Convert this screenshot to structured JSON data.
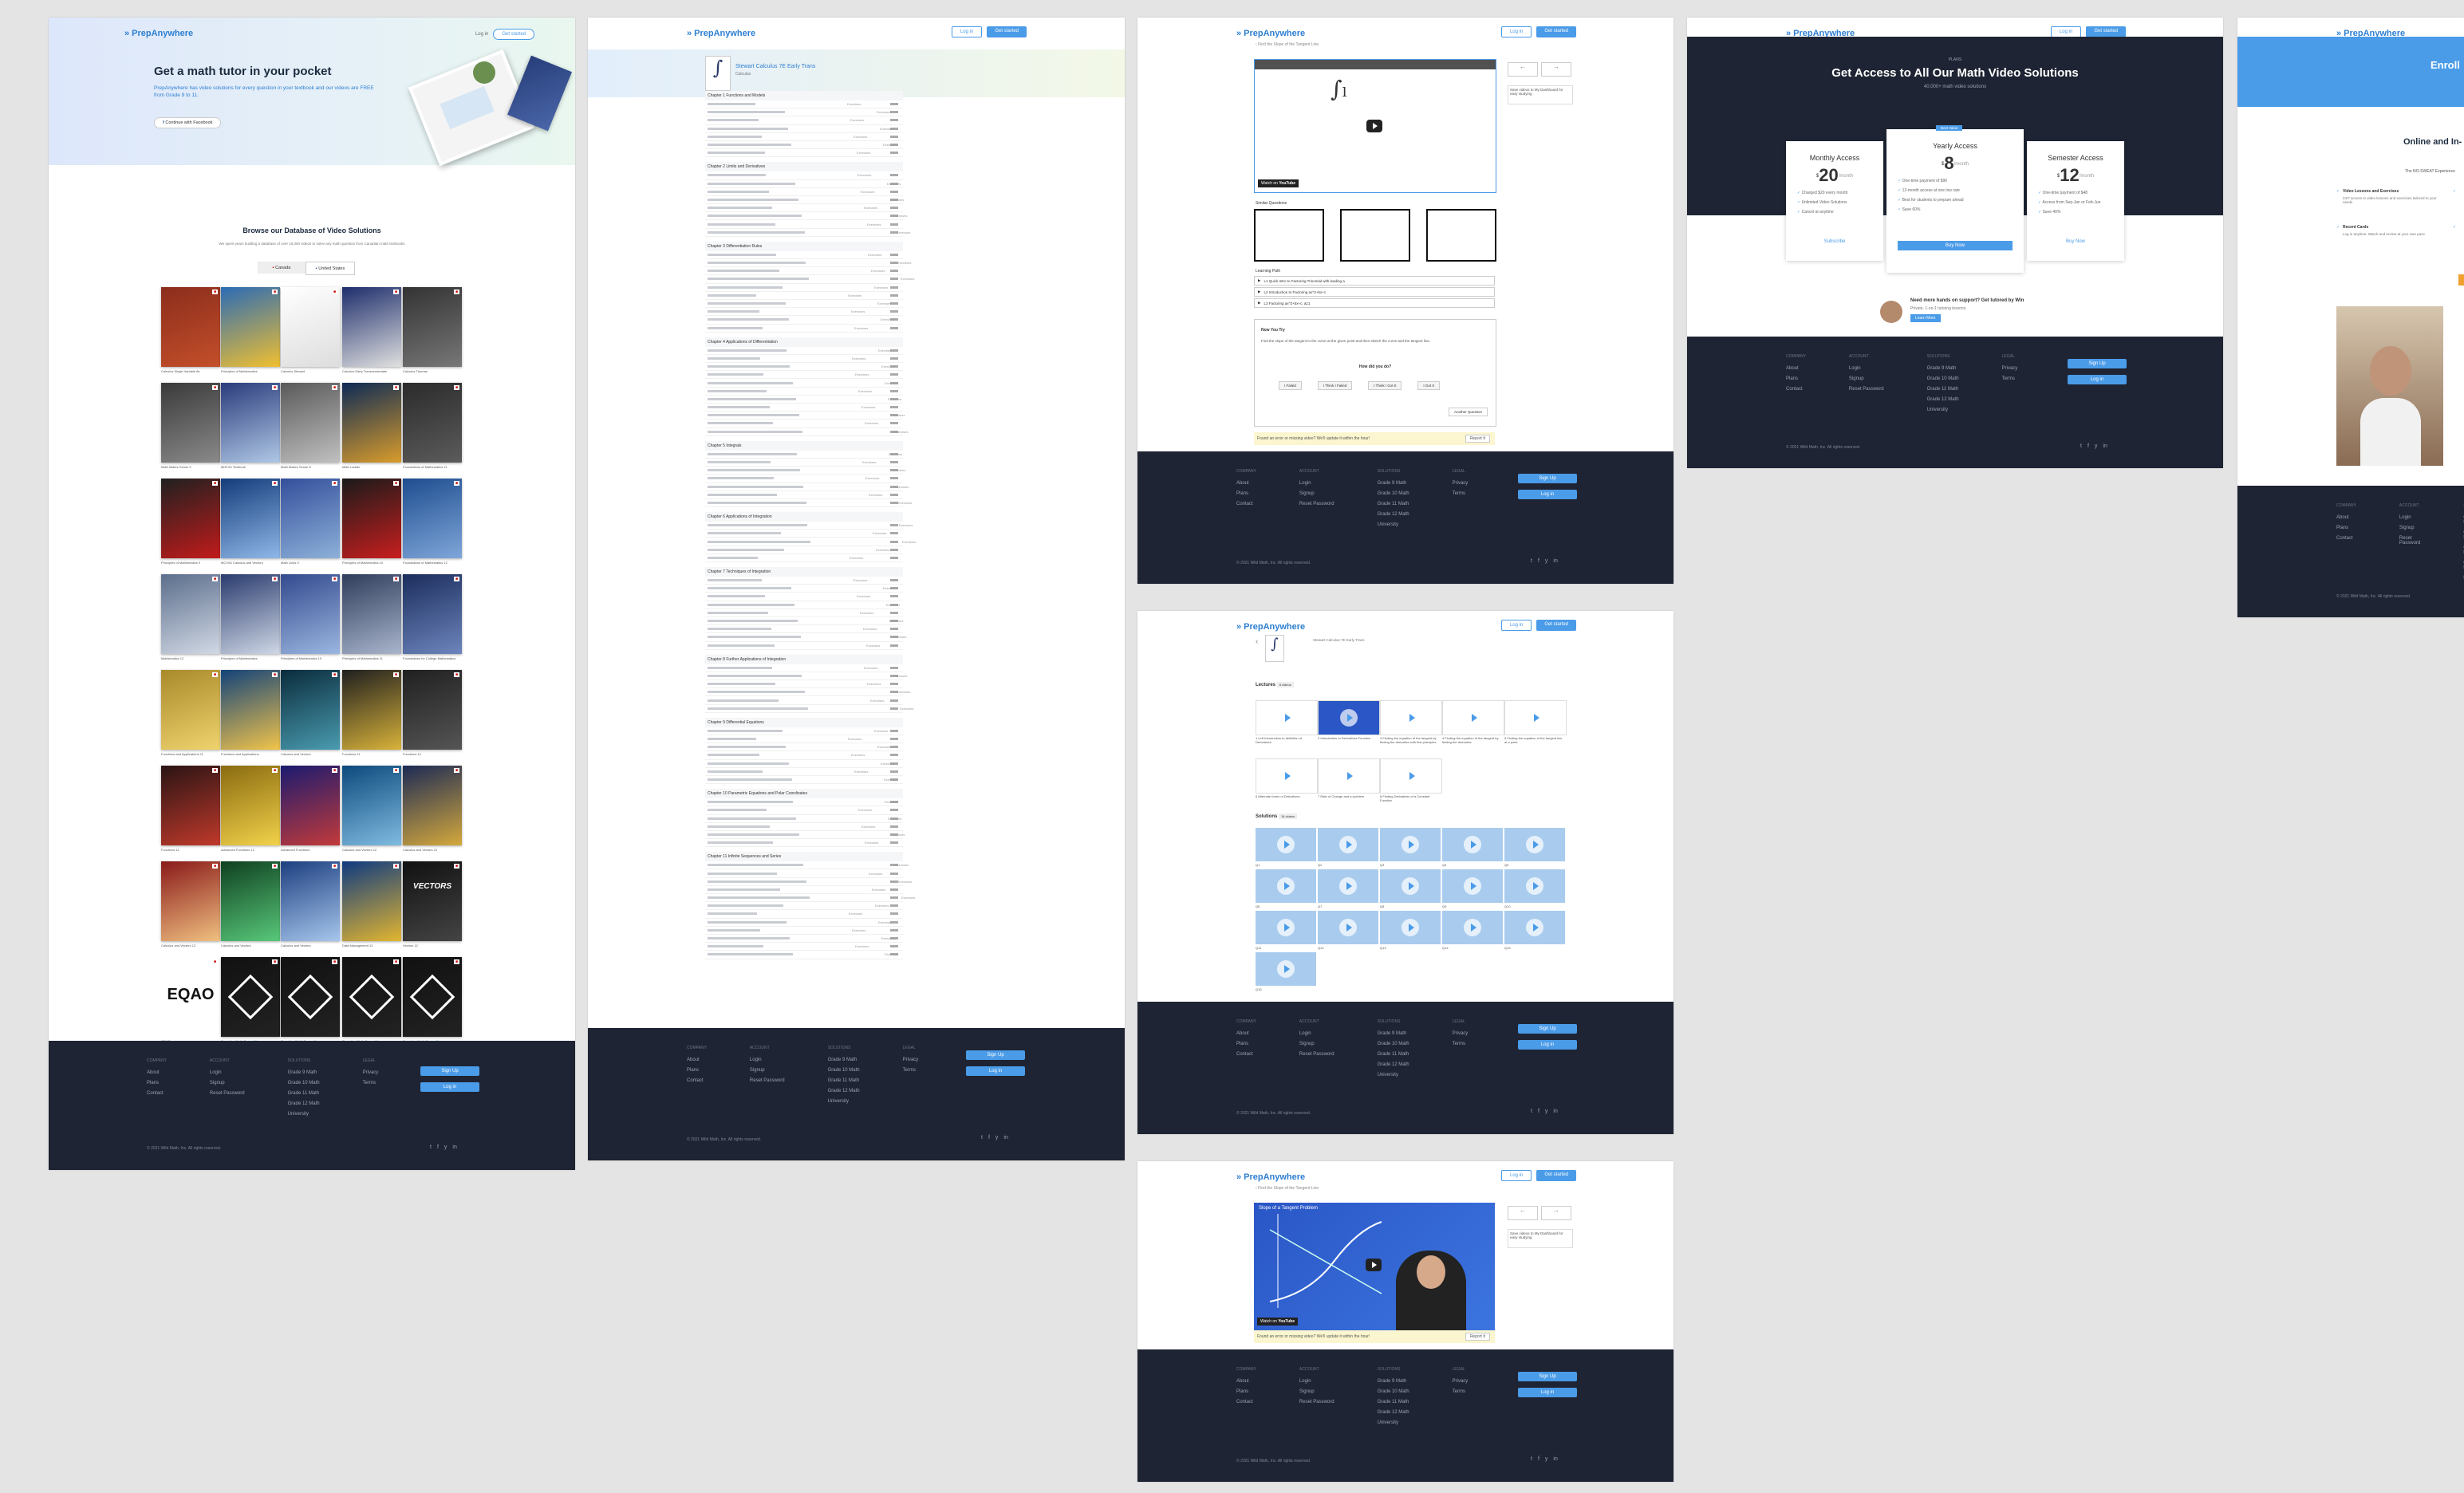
{
  "brand": {
    "name": "PrepAnywhere",
    "accent": "#4a9be8",
    "footer_bg": "#1e2433"
  },
  "nav": {
    "login": "Log in",
    "signup": "Get started"
  },
  "home": {
    "hero_title": "Get a math tutor in your pocket",
    "hero_sub": "PrepAnywhere has video solutions for every question in your textbook and our videos are FREE from Grade 9 to 11.",
    "hero_btn": "Continue with Facebook",
    "db_title": "Browse our Database of Video Solutions",
    "db_sub": "We spent years building a database of over 10,000 videos to solve any math question from Canadian math textbooks",
    "tab_canada": "Canada",
    "tab_us": "United States",
    "book_titles": [
      "Calculus Single Variable 8e",
      "Principles of Mathematics",
      "Calculus Stewart",
      "Calculus Early Transcendentals",
      "Calculus Thomas",
      "Math Makes Sense 9",
      "MHF4U Textbook",
      "Math Makes Sense 8",
      "Math Ladder",
      "Foundations of Mathematics 11",
      "Principles of Mathematics 9",
      "MCV4U Calculus and Vectors",
      "Math Links 9",
      "Principles of Mathematics 10",
      "Foundations of Mathematics 12",
      "Mathematics 12",
      "Principles of Mathematics",
      "Principles of Mathematics 10",
      "Principles of Mathematics 11",
      "Foundations for College Mathematics",
      "Functions and Applications 11",
      "Functions and Applications",
      "Calculus and Vectors",
      "Functions 11",
      "Functions 12",
      "Functions 11",
      "Advanced Functions 12",
      "Advanced Functions",
      "Calculus and Vectors 12",
      "Calculus and Vectors 12",
      "Calculus and Vectors 12",
      "Calculus and Vectors",
      "Calculus and Vectors",
      "Data Management 12",
      "Vectors 12",
      "EQAO",
      "Canadian Math Competition",
      "Canadian Math Competition",
      "Canadian Math Competition",
      "Canadian Math Competition"
    ],
    "eqao": "EQAO",
    "vectors": "VECTORS"
  },
  "toc": {
    "book_title": "Stewart Calculus 7E Early Trans",
    "book_sub": "Calculus",
    "chapters": [
      "Chapter 1 Functions and Models",
      "Chapter 2 Limits and Derivatives",
      "Chapter 3 Differentiation Rules",
      "Chapter 4 Applications of Differentiation",
      "Chapter 5 Integrals",
      "Chapter 6 Applications of Integration",
      "Chapter 7 Techniques of Integration",
      "Chapter 8 Further Applications of Integration",
      "Chapter 9 Differential Equations",
      "Chapter 10 Parametric Equations and Polar Coordinates",
      "Chapter 11 Infinite Sequences and Series"
    ],
    "row_counts": [
      7,
      8,
      10,
      11,
      7,
      5,
      9,
      6,
      7,
      6,
      12
    ],
    "exercise": "Exercises"
  },
  "video": {
    "breadcrumb": "Find the Slope of the Tangent Line",
    "yt_watch": "Watch on",
    "yt": "YouTube",
    "similar": "Similar Questions",
    "learning_path": "Learning Path",
    "lp": [
      "L1 Quick Intro to Factoring Trinomial with leading a",
      "L2 Introduction to Factoring ax^2+bx+c",
      "L3 Factoring ax^2+bx+c, a≠1"
    ],
    "now_try": "Now You Try",
    "question": "Find the slope of the tangent to the curve at the given point and then sketch the curve and the tangent line.",
    "how_did": "How did you do?",
    "opts": [
      "I Failed",
      "I Think I Failed",
      "I Think I Got It",
      "I Got It"
    ],
    "another": "Another Question",
    "error": "Found an error or missing video? We'll update it within the hour!",
    "report": "Report It",
    "sideinfo": "Save videos to My Dashboard for easy studying",
    "video_title2": "Slope of a Tangent Problem"
  },
  "chapter": {
    "title": "Stewart Calculus 7E Early Trans",
    "lectures": "Lectures",
    "lectures_badge": "8 videos",
    "lecture_labels": [
      "1 Left Introduction to definition of Derivatives",
      "2 Introduction to Derivatives Function",
      "3 Finding the equation of the tangent by finding the derivative with first principles",
      "4 Finding the equation of the tangent by finding the derivative",
      "5 Finding the equation of the tangent line at a point",
      "6 Alternate forms of Derivatives",
      "7 Rate of Change and a problem",
      "8 Finding Derivatives of a Constant Function"
    ],
    "solutions": "Solutions",
    "solutions_badge": "16 videos",
    "sol_labels": [
      "Q1",
      "Q2",
      "Q3",
      "Q4",
      "Q5",
      "Q6",
      "Q7",
      "Q8",
      "Q9",
      "Q10",
      "Q11",
      "Q12",
      "Q13",
      "Q14",
      "Q15",
      "Q16"
    ]
  },
  "pricing": {
    "label": "PLANS",
    "title": "Get Access to All Our Math Video Solutions",
    "sub": "40,000+ math video solutions",
    "badge": "Best Value",
    "plans": [
      {
        "name": "Monthly Access",
        "price": "20",
        "per": "/month",
        "features": [
          "Charged $20 every month",
          "Unlimited Video Solutions",
          "Cancel at anytime"
        ],
        "cta": "Subscribe"
      },
      {
        "name": "Yearly Access",
        "price": "8",
        "per": "/month",
        "features": [
          "One-time payment of $96",
          "12-month access at one low rate",
          "Best for students to prepare ahead",
          "Save 60%"
        ],
        "cta": "Buy Now"
      },
      {
        "name": "Semester Access",
        "price": "12",
        "per": "/month",
        "features": [
          "One-time payment of $48",
          "Access from Sep-Jan or Feb-Jun",
          "Save 40%"
        ],
        "cta": "Buy Now"
      }
    ],
    "tutor_title": "Need more hands on support? Get tutored by Win",
    "tutor_sub": "Private, 1-on-1 tutoring lessons",
    "tutor_btn": "Learn More"
  },
  "enroll": {
    "title": "Enroll",
    "heading": "Online and In-",
    "sub": "The NO-SWEAT Experience",
    "items": [
      "Video Lessons and Exercises",
      "Recent Cards"
    ],
    "item_subs": [
      "24/7 access to video lessons and exercises tailored to your needs",
      "Log in anytime. Watch and review at your own pace"
    ]
  },
  "footer": {
    "h_company": "Company",
    "h_account": "Account",
    "h_solutions": "Solutions",
    "h_legal": "Legal",
    "company": [
      "About",
      "Plans",
      "Contact"
    ],
    "account": [
      "Login",
      "Signup",
      "Reset Password"
    ],
    "solutions": [
      "Grade 9 Math",
      "Grade 10 Math",
      "Grade 11 Math",
      "Grade 12 Math",
      "University"
    ],
    "legal": [
      "Privacy",
      "Terms"
    ],
    "signup": "Sign Up",
    "login": "Log in",
    "copy": "© 2021 Wild Math, Inc. All rights reserved.",
    "social": [
      "t",
      "f",
      "y",
      "in"
    ]
  }
}
